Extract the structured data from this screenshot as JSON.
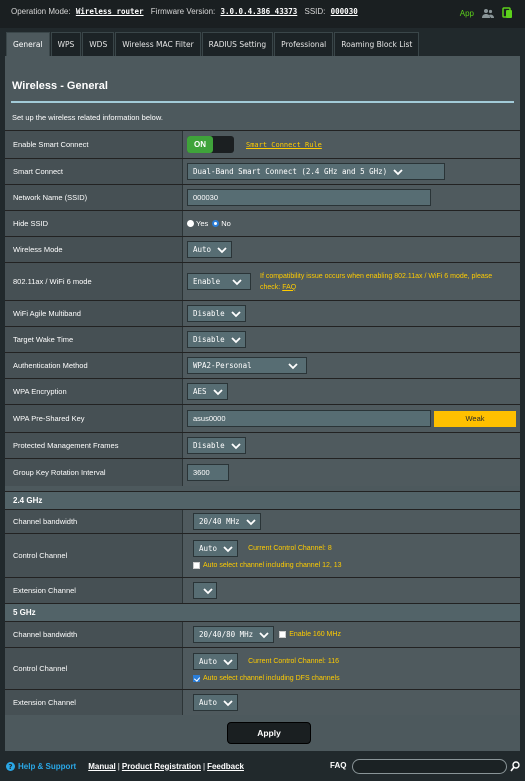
{
  "topbar": {
    "op_mode_label": "Operation Mode:",
    "op_mode_value": "Wireless router",
    "fw_label": "Firmware Version:",
    "fw_value": "3.0.0.4.386_43373",
    "ssid_label": "SSID:",
    "ssid_value": "000030",
    "app_label": "App"
  },
  "tabs": [
    "General",
    "WPS",
    "WDS",
    "Wireless MAC Filter",
    "RADIUS Setting",
    "Professional",
    "Roaming Block List"
  ],
  "page": {
    "title": "Wireless - General",
    "description": "Set up the wireless related information below."
  },
  "form": {
    "smart_connect_enable": {
      "label": "Enable Smart Connect",
      "state": "ON",
      "rule_link": "Smart Connect Rule"
    },
    "smart_connect": {
      "label": "Smart Connect",
      "value": "Dual-Band Smart Connect (2.4 GHz and 5 GHz)"
    },
    "ssid": {
      "label": "Network Name (SSID)",
      "value": "000030"
    },
    "hide_ssid": {
      "label": "Hide SSID",
      "yes": "Yes",
      "no": "No",
      "selected": "No"
    },
    "wireless_mode": {
      "label": "Wireless Mode",
      "value": "Auto"
    },
    "ax_mode": {
      "label": "802.11ax / WiFi 6 mode",
      "value": "Enable",
      "note": "If compatibility issue occurs when enabling 802.11ax / WiFi 6 mode, please check:",
      "note_link": "FAQ"
    },
    "agile_multiband": {
      "label": "WiFi Agile Multiband",
      "value": "Disable"
    },
    "target_wake_time": {
      "label": "Target Wake Time",
      "value": "Disable"
    },
    "auth_method": {
      "label": "Authentication Method",
      "value": "WPA2-Personal"
    },
    "wpa_encryption": {
      "label": "WPA Encryption",
      "value": "AES"
    },
    "wpa_psk": {
      "label": "WPA Pre-Shared Key",
      "value": "asus0000",
      "strength": "Weak",
      "strength_color": "#ffc000"
    },
    "pmf": {
      "label": "Protected Management Frames",
      "value": "Disable"
    },
    "gk_rotation": {
      "label": "Group Key Rotation Interval",
      "value": "3600"
    }
  },
  "band24": {
    "header": "2.4 GHz",
    "bandwidth": {
      "label": "Channel bandwidth",
      "value": "20/40 MHz"
    },
    "control_channel": {
      "label": "Control Channel",
      "value": "Auto",
      "current": "Current Control Channel: 8",
      "checkbox_label": "Auto select channel including channel 12, 13",
      "checked": false
    },
    "extension_channel": {
      "label": "Extension Channel",
      "value": ""
    }
  },
  "band5": {
    "header": "5 GHz",
    "bandwidth": {
      "label": "Channel bandwidth",
      "value": "20/40/80 MHz",
      "checkbox_label": "Enable 160 MHz",
      "checked": false
    },
    "control_channel": {
      "label": "Control Channel",
      "value": "Auto",
      "current": "Current Control Channel: 116",
      "checkbox_label": "Auto select channel including DFS channels",
      "checked": true
    },
    "extension_channel": {
      "label": "Extension Channel",
      "value": "Auto"
    }
  },
  "apply_label": "Apply",
  "footer": {
    "help": "Help & Support",
    "manual": "Manual",
    "product_registration": "Product Registration",
    "feedback": "Feedback",
    "faq": "FAQ",
    "sep": "|"
  },
  "colors": {
    "accent_green": "#3fa33a",
    "note_yellow": "#ffcc00",
    "help_blue": "#2aa7e6"
  }
}
